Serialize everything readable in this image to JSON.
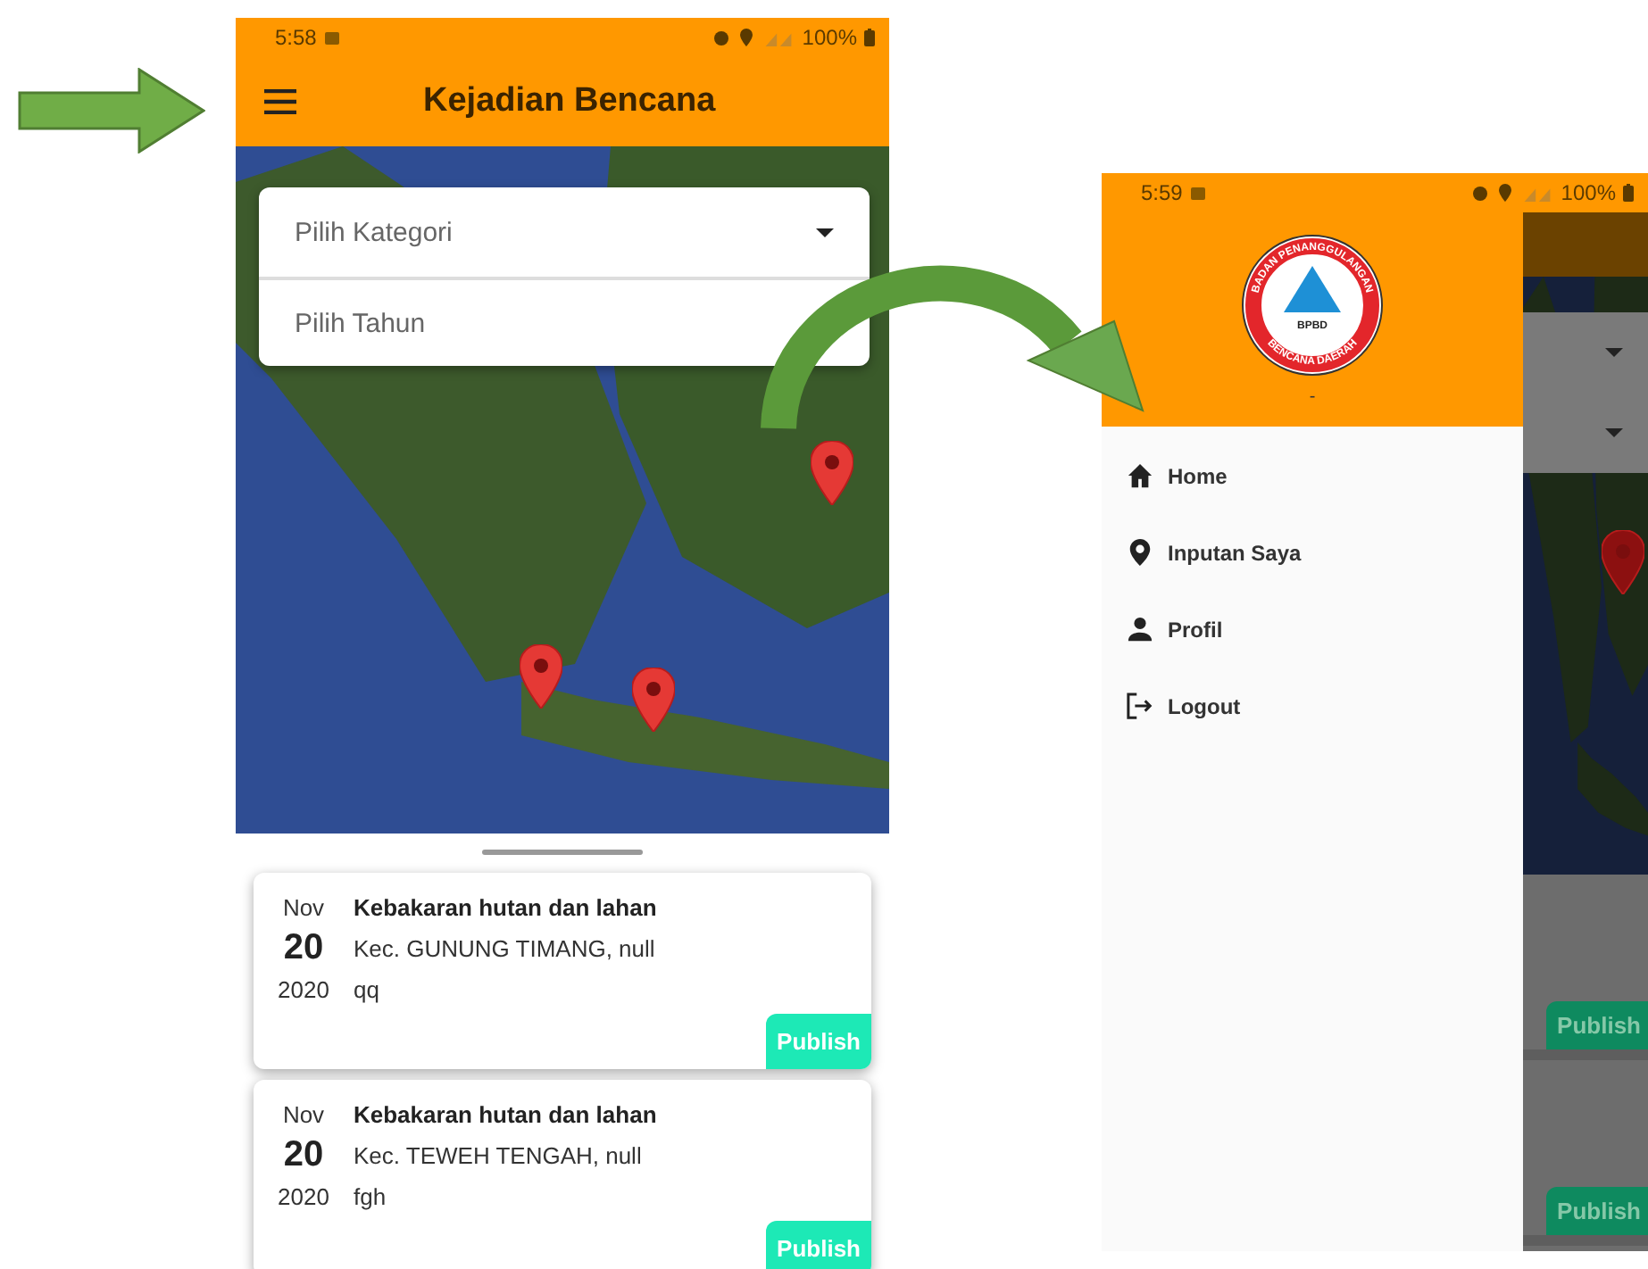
{
  "left_screen": {
    "status_bar": {
      "time": "5:58",
      "battery": "100%"
    },
    "app_bar": {
      "title": "Kejadian Bencana"
    },
    "filters": [
      {
        "placeholder": "Pilih Kategori",
        "kind": "dropdown"
      },
      {
        "placeholder": "Pilih Tahun",
        "kind": "text"
      }
    ],
    "reports": [
      {
        "month": "Nov",
        "day": "20",
        "year": "2020",
        "title": "Kebakaran hutan dan lahan",
        "location": "Kec. GUNUNG TIMANG, null",
        "description": "qq",
        "action": "Publish"
      },
      {
        "month": "Nov",
        "day": "20",
        "year": "2020",
        "title": "Kebakaran hutan dan lahan",
        "location": "Kec. TEWEH TENGAH, null",
        "description": "fgh",
        "action": "Publish"
      }
    ]
  },
  "right_screen": {
    "status_bar": {
      "time": "5:59",
      "battery": "100%"
    },
    "logo": {
      "ring_top": "BADAN PENANGGULANGAN",
      "ring_bottom": "BENCANA DAERAH",
      "center": "BPBD"
    },
    "account": "-",
    "menu": [
      {
        "label": "Home",
        "kind": "home"
      },
      {
        "label": "Inputan Saya",
        "kind": "pin"
      },
      {
        "label": "Profil",
        "kind": "person"
      },
      {
        "label": "Logout",
        "kind": "logout"
      }
    ],
    "background_actions": [
      "Publish",
      "Publish"
    ]
  }
}
